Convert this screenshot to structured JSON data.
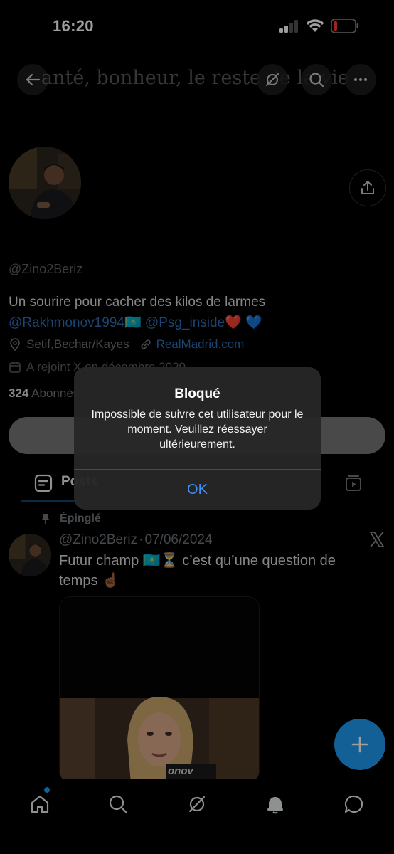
{
  "status_bar": {
    "time": "16:20"
  },
  "header": {
    "title": "anté, bonheur, le reste de la vie"
  },
  "profile": {
    "handle": "@Zino2Beriz",
    "bio_line1": "Un sourire pour cacher des kilos de larmes",
    "bio_mention1": "@Rakhmonov1994",
    "bio_flag": "🇰🇿",
    "bio_mention2": "@Psg_inside",
    "bio_hearts": "❤️ 💙",
    "location": "Setif,Bechar/Kayes",
    "website": "RealMadrid.com",
    "joined": "A rejoint X en décembre 2020",
    "followers_count": "324",
    "followers_label": "Abonnés"
  },
  "tabs": {
    "posts_label": "Posts"
  },
  "pinned_tweet": {
    "pinned_label": "Épinglé",
    "author_handle": "@Zino2Beriz",
    "separator": "·",
    "date": "07/06/2024",
    "text_part1": "Futur champ",
    "text_emojis": "🇰🇿⏳",
    "text_part2": "c’est qu’une question de temps",
    "text_emoji_end": "☝🏾",
    "media_caption": "onov"
  },
  "alert": {
    "title": "Bloqué",
    "message": "Impossible de suivre cet utilisateur pour le moment. Veuillez réessayer ultérieurement.",
    "ok_label": "OK"
  },
  "colors": {
    "accent": "#1d9bf0",
    "link": "#2d6fb5",
    "alert_button": "#3d8ff5",
    "battery_low": "#ff3b30"
  }
}
